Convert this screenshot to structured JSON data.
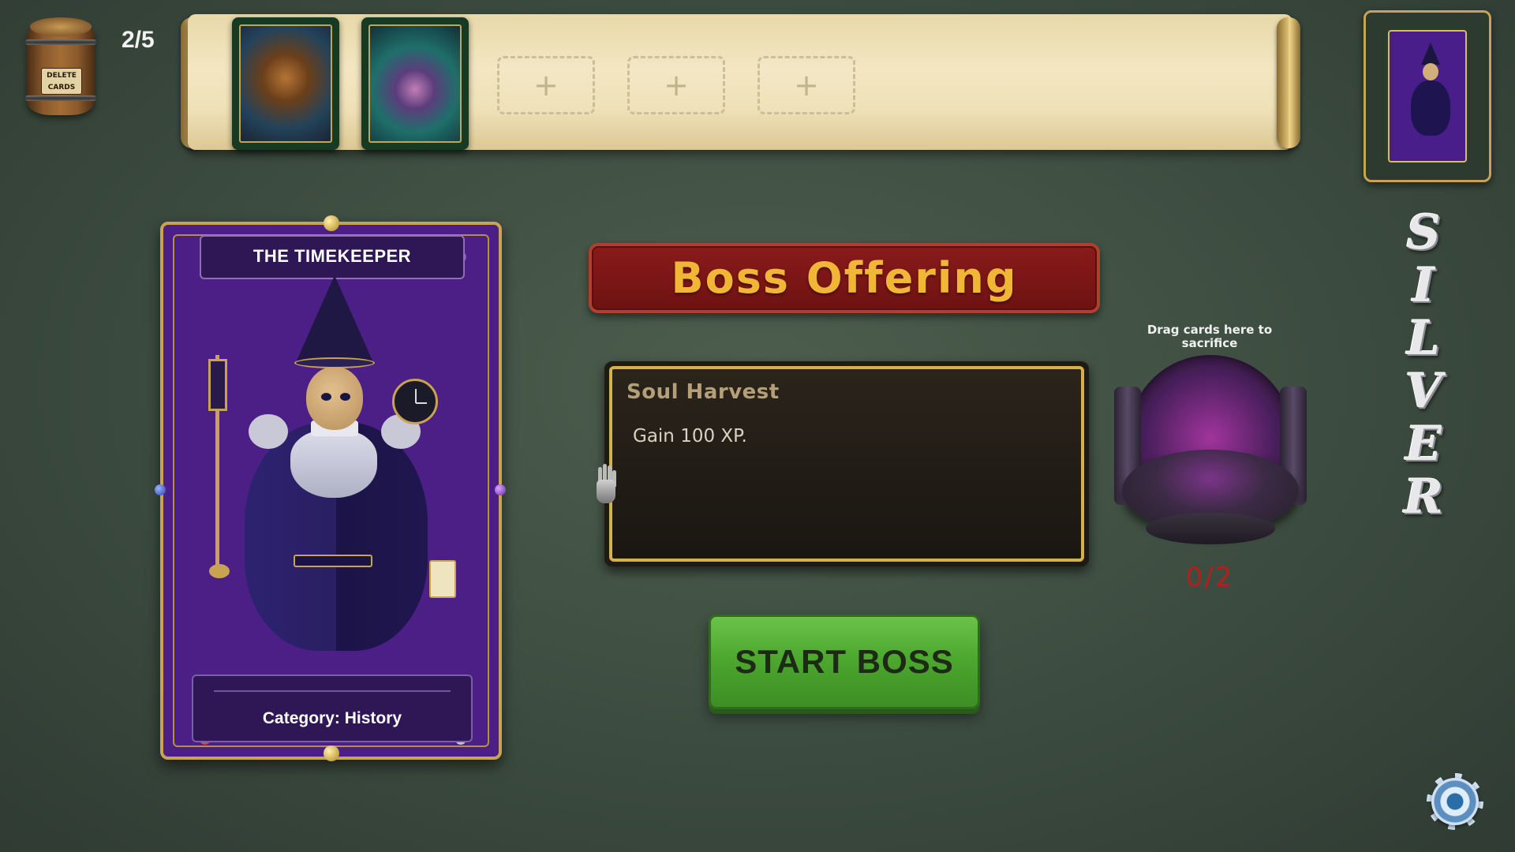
{
  "deck": {
    "barrel_label": "DELETE CARDS",
    "count_text": "2/5",
    "filled_cards": [
      {
        "name": "bear-scholar-card",
        "icon": "bear-scholar-art"
      },
      {
        "name": "serpent-card",
        "icon": "serpent-art"
      }
    ],
    "empty_slot_glyph": "+",
    "empty_slots": 3
  },
  "boss_preview": {
    "icon": "timekeeper-mini-art"
  },
  "boss_card": {
    "title": "THE TIMEKEEPER",
    "category": "Category: History",
    "colors": {
      "card": "#4b1f86",
      "frame": "#c9a352"
    }
  },
  "banner": {
    "title": "Boss Offering"
  },
  "offering": {
    "title": "Soul Harvest",
    "description": "Gain 100 XP."
  },
  "start_button": {
    "label": "START BOSS",
    "color": "#4da82f"
  },
  "altar": {
    "hint": "Drag cards here to sacrifice",
    "count_text": "0/2",
    "count_color": "#b3201b"
  },
  "rank": {
    "letters": [
      "S",
      "I",
      "L",
      "V",
      "E",
      "R"
    ]
  },
  "settings": {
    "icon": "gear-icon"
  }
}
